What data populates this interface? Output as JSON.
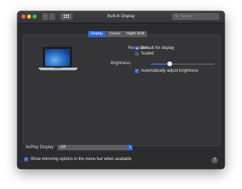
{
  "window": {
    "title": "Built-in Display",
    "search_placeholder": "Search"
  },
  "tabs": [
    {
      "label": "Display"
    },
    {
      "label": "Colour"
    },
    {
      "label": "Night Shift"
    }
  ],
  "display": {
    "resolution_label": "Resolution:",
    "resolution_options": [
      {
        "label": "Default for display",
        "selected": true
      },
      {
        "label": "Scaled",
        "selected": false
      }
    ],
    "brightness_label": "Brightness:",
    "brightness_value": 0.3,
    "auto_brightness_label": "Automatically adjust brightness",
    "auto_brightness_checked": true
  },
  "airplay": {
    "label": "AirPlay Display:",
    "value": "Off"
  },
  "mirroring": {
    "label": "Show mirroring options in the menu bar when available",
    "checked": true
  },
  "colors": {
    "accent": "#2e66d8",
    "window_bg": "#2c2c2e"
  }
}
